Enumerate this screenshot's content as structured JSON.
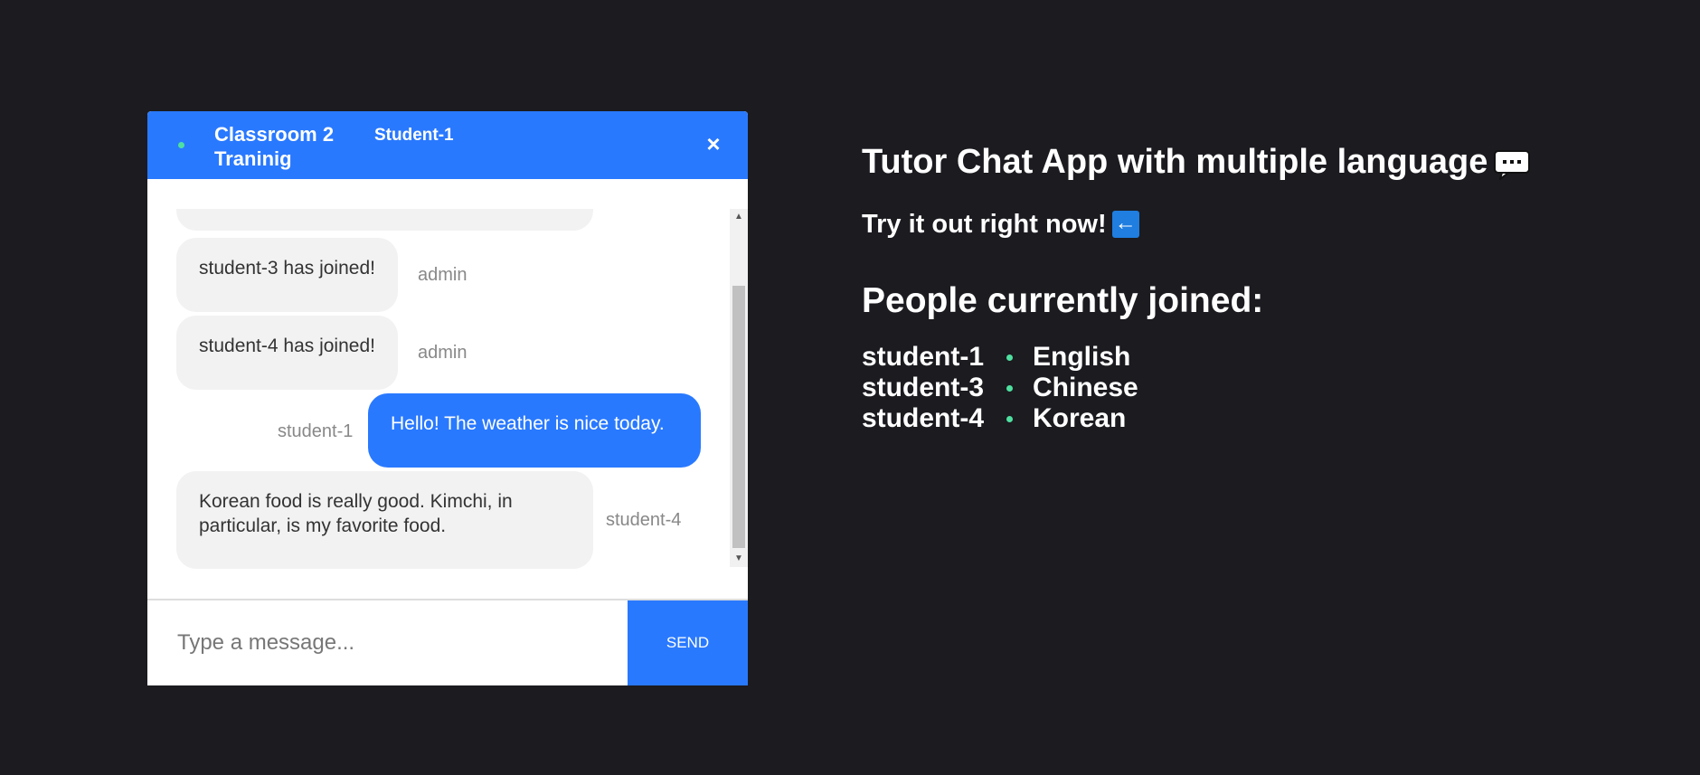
{
  "chat": {
    "room_title": "Classroom 2 Traninig",
    "current_user": "Student-1",
    "close_label": "×",
    "messages": [
      {
        "text": "student-3 has joined!",
        "sender": "admin",
        "mine": false
      },
      {
        "text": "student-4 has joined!",
        "sender": "admin",
        "mine": false
      },
      {
        "text": "Hello! The weather is nice today.",
        "sender": "student-1",
        "mine": true
      },
      {
        "text": "Korean food is really good. Kimchi, in particular, is my favorite food.",
        "sender": "student-4",
        "mine": false
      }
    ],
    "input_placeholder": "Type a message...",
    "send_label": "SEND"
  },
  "info": {
    "app_title": "Tutor Chat App with multiple language",
    "try_text": "Try it out right now!",
    "people_heading": "People currently joined:",
    "people": [
      {
        "name": "student-1",
        "language": "English"
      },
      {
        "name": "student-3",
        "language": "Chinese"
      },
      {
        "name": "student-4",
        "language": "Korean"
      }
    ]
  },
  "colors": {
    "background": "#1b1b20",
    "accent": "#2979ff",
    "online": "#4fe0a0"
  },
  "icons": {
    "title_icon": "speech-balloon-icon",
    "try_icon": "left-arrow-icon"
  }
}
